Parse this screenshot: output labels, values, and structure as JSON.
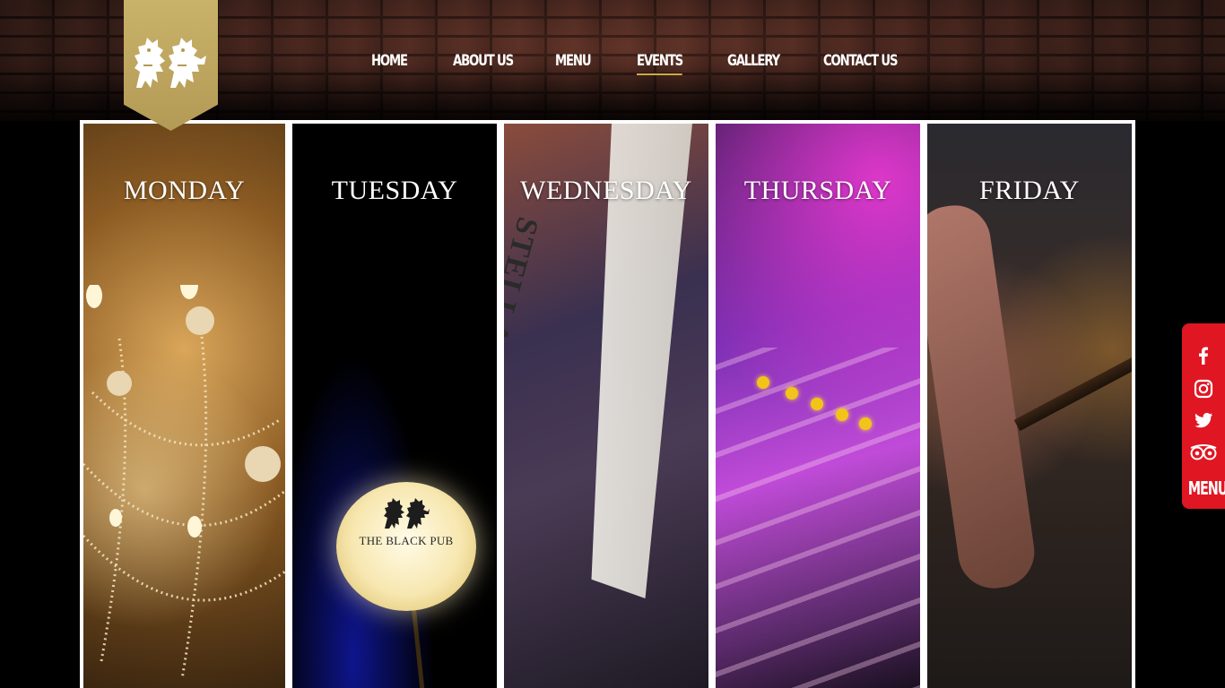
{
  "brand": {
    "logo_icon": "lion-crest-icon",
    "banner_color": "#c0a762"
  },
  "nav": {
    "items": [
      {
        "label": "HOME",
        "active": false
      },
      {
        "label": "ABOUT US",
        "active": false
      },
      {
        "label": "MENU",
        "active": false
      },
      {
        "label": "EVENTS",
        "active": true
      },
      {
        "label": "GALLERY",
        "active": false
      },
      {
        "label": "CONTACT US",
        "active": false
      }
    ],
    "active_underline_color": "#c9a94a"
  },
  "events": {
    "days": [
      {
        "title": "MONDAY",
        "image": "chandelier-photo"
      },
      {
        "title": "TUESDAY",
        "image": "lit-lamp-photo"
      },
      {
        "title": "WEDNESDAY",
        "image": "stella-artois-flag-photo"
      },
      {
        "title": "THURSDAY",
        "image": "mixing-console-photo"
      },
      {
        "title": "FRIDAY",
        "image": "guitarist-photo"
      }
    ],
    "lamp_text": "THE BLACK PUB",
    "flag_text": "STELLA ARTOIS"
  },
  "social": {
    "background_color": "#e01622",
    "icons": [
      "facebook-icon",
      "instagram-icon",
      "twitter-icon",
      "tripadvisor-icon"
    ],
    "menu_label": "MENU"
  }
}
